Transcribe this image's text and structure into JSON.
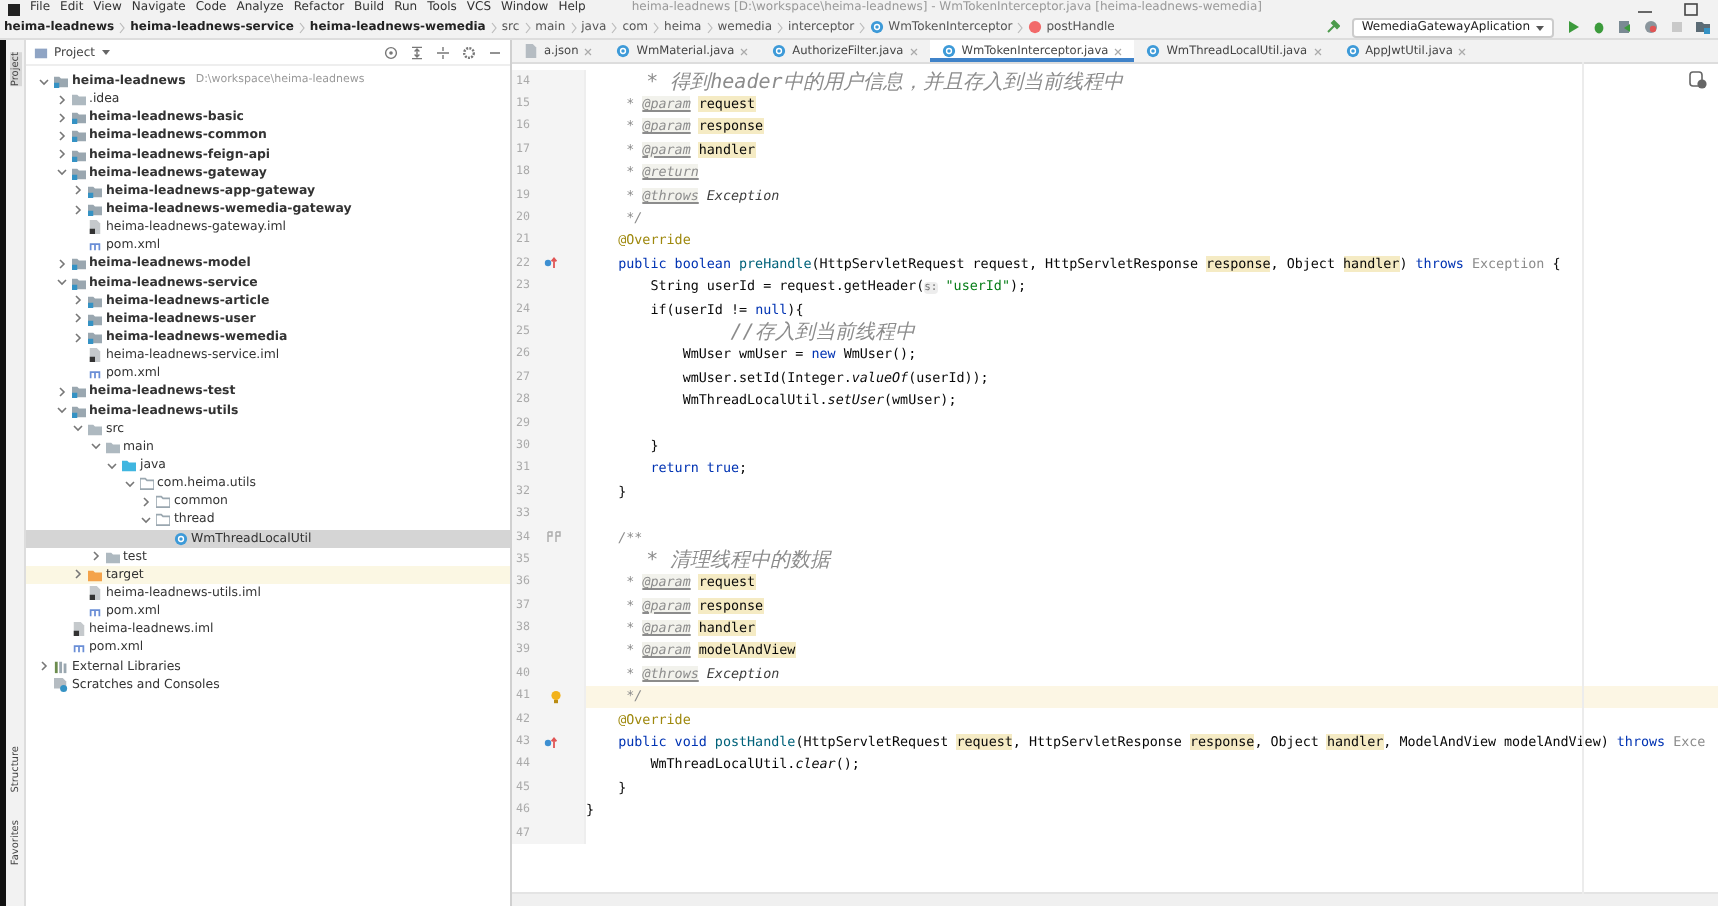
{
  "title_bar": {
    "menu": [
      "File",
      "Edit",
      "View",
      "Navigate",
      "Code",
      "Analyze",
      "Refactor",
      "Build",
      "Run",
      "Tools",
      "VCS",
      "Window",
      "Help"
    ],
    "title": "heima-leadnews [D:\\workspace\\heima-leadnews] - WmTokenInterceptor.java [heima-leadnews-wemedia]"
  },
  "breadcrumbs": [
    {
      "label": "heima-leadnews",
      "kind": "module"
    },
    {
      "label": "heima-leadnews-service",
      "kind": "module"
    },
    {
      "label": "heima-leadnews-wemedia",
      "kind": "module"
    },
    {
      "label": "src",
      "kind": "folder"
    },
    {
      "label": "main",
      "kind": "folder"
    },
    {
      "label": "java",
      "kind": "folder"
    },
    {
      "label": "com",
      "kind": "folder"
    },
    {
      "label": "heima",
      "kind": "folder"
    },
    {
      "label": "wemedia",
      "kind": "folder"
    },
    {
      "label": "interceptor",
      "kind": "folder"
    },
    {
      "label": "WmTokenInterceptor",
      "kind": "class"
    },
    {
      "label": "postHandle",
      "kind": "method"
    }
  ],
  "run_config": "WemediaGatewayAplication",
  "side_strip": [
    "Project",
    "Structure",
    "Favorites"
  ],
  "project": {
    "title": "Project",
    "tree": [
      {
        "label": "heima-leadnews",
        "hint": "D:\\workspace\\heima-leadnews",
        "kind": "module",
        "expanded": true,
        "selected": false,
        "children": [
          {
            "label": ".idea",
            "kind": "folder",
            "expanded": false,
            "selected": false
          },
          {
            "label": "heima-leadnews-basic",
            "kind": "module",
            "expanded": false,
            "selected": false
          },
          {
            "label": "heima-leadnews-common",
            "kind": "module",
            "expanded": false,
            "selected": false
          },
          {
            "label": "heima-leadnews-feign-api",
            "kind": "module",
            "expanded": false,
            "selected": false
          },
          {
            "label": "heima-leadnews-gateway",
            "kind": "module",
            "expanded": true,
            "selected": false,
            "children": [
              {
                "label": "heima-leadnews-app-gateway",
                "kind": "module",
                "expanded": false,
                "selected": false
              },
              {
                "label": "heima-leadnews-wemedia-gateway",
                "kind": "module",
                "expanded": false,
                "selected": false
              },
              {
                "label": "heima-leadnews-gateway.iml",
                "kind": "iml",
                "selected": false
              },
              {
                "label": "pom.xml",
                "kind": "pom",
                "selected": false
              }
            ]
          },
          {
            "label": "heima-leadnews-model",
            "kind": "module",
            "expanded": false,
            "selected": false
          },
          {
            "label": "heima-leadnews-service",
            "kind": "module",
            "expanded": true,
            "selected": false,
            "children": [
              {
                "label": "heima-leadnews-article",
                "kind": "module",
                "expanded": false,
                "selected": false
              },
              {
                "label": "heima-leadnews-user",
                "kind": "module",
                "expanded": false,
                "selected": false
              },
              {
                "label": "heima-leadnews-wemedia",
                "kind": "module",
                "expanded": false,
                "selected": false
              },
              {
                "label": "heima-leadnews-service.iml",
                "kind": "iml",
                "selected": false
              },
              {
                "label": "pom.xml",
                "kind": "pom",
                "selected": false
              }
            ]
          },
          {
            "label": "heima-leadnews-test",
            "kind": "module",
            "expanded": false,
            "selected": false
          },
          {
            "label": "heima-leadnews-utils",
            "kind": "module",
            "expanded": true,
            "selected": false,
            "children": [
              {
                "label": "src",
                "kind": "folder",
                "expanded": true,
                "selected": false,
                "children": [
                  {
                    "label": "main",
                    "kind": "folder",
                    "expanded": true,
                    "selected": false,
                    "children": [
                      {
                        "label": "java",
                        "kind": "source",
                        "expanded": true,
                        "selected": false,
                        "children": [
                          {
                            "label": "com.heima.utils",
                            "kind": "package",
                            "expanded": true,
                            "selected": false,
                            "children": [
                              {
                                "label": "common",
                                "kind": "package",
                                "expanded": false,
                                "selected": false
                              },
                              {
                                "label": "thread",
                                "kind": "package",
                                "expanded": true,
                                "selected": false,
                                "children": [
                                  {
                                    "label": "WmThreadLocalUtil",
                                    "kind": "class",
                                    "selected": true
                                  }
                                ]
                              }
                            ]
                          }
                        ]
                      }
                    ]
                  },
                  {
                    "label": "test",
                    "kind": "folder",
                    "expanded": false,
                    "selected": false
                  }
                ]
              },
              {
                "label": "target",
                "kind": "excluded",
                "expanded": false,
                "selected": false
              },
              {
                "label": "heima-leadnews-utils.iml",
                "kind": "iml",
                "selected": false
              },
              {
                "label": "pom.xml",
                "kind": "pom",
                "selected": false
              }
            ]
          },
          {
            "label": "heima-leadnews.iml",
            "kind": "iml",
            "selected": false
          },
          {
            "label": "pom.xml",
            "kind": "pom",
            "selected": false
          }
        ]
      },
      {
        "label": "External Libraries",
        "kind": "libraries",
        "expanded": false,
        "selected": false
      },
      {
        "label": "Scratches and Consoles",
        "kind": "scratches",
        "selected": false
      }
    ]
  },
  "tabs": [
    {
      "label": "a.json",
      "kind": "json",
      "selected": false
    },
    {
      "label": "WmMaterial.java",
      "kind": "class",
      "selected": false
    },
    {
      "label": "AuthorizeFilter.java",
      "kind": "class",
      "selected": false
    },
    {
      "label": "WmTokenInterceptor.java",
      "kind": "class",
      "selected": true
    },
    {
      "label": "WmThreadLocalUtil.java",
      "kind": "class",
      "selected": false
    },
    {
      "label": "AppJwtUtil.java",
      "kind": "class",
      "selected": false
    }
  ],
  "code": [
    {
      "number": "14",
      "kind": "plain",
      "current": false,
      "segments": [
        {
          "kind": "comment",
          "text": "     * 得到header中的用户信息，并且存入到当前线程中"
        }
      ]
    },
    {
      "number": "15",
      "kind": "plain",
      "current": false,
      "segments": [
        {
          "kind": "comment",
          "text": "     * "
        },
        {
          "kind": "doctag",
          "text": "@param"
        },
        {
          "kind": "param",
          "text": "request"
        }
      ]
    },
    {
      "number": "16",
      "kind": "plain",
      "current": false,
      "segments": [
        {
          "kind": "comment",
          "text": "     * "
        },
        {
          "kind": "doctag",
          "text": "@param"
        },
        {
          "kind": "param",
          "text": "response"
        }
      ]
    },
    {
      "number": "17",
      "kind": "plain",
      "current": false,
      "segments": [
        {
          "kind": "comment",
          "text": "     * "
        },
        {
          "kind": "doctag",
          "text": "@param"
        },
        {
          "kind": "param",
          "text": "handler"
        }
      ]
    },
    {
      "number": "18",
      "kind": "plain",
      "current": false,
      "segments": [
        {
          "kind": "comment",
          "text": "     * "
        },
        {
          "kind": "doctag",
          "text": "@return"
        }
      ]
    },
    {
      "number": "19",
      "kind": "plain",
      "current": false,
      "segments": [
        {
          "kind": "comment",
          "text": "     * "
        },
        {
          "kind": "doctag",
          "text": "@throws"
        },
        {
          "kind": "doctype",
          "text": "Exception"
        }
      ]
    },
    {
      "number": "20",
      "kind": "plain",
      "current": false,
      "segments": [
        {
          "kind": "comment",
          "text": "     */"
        }
      ]
    },
    {
      "number": "21",
      "kind": "plain",
      "current": false,
      "segments": [
        {
          "kind": "annotation",
          "text": "    @Override"
        }
      ]
    },
    {
      "number": "22",
      "kind": "override",
      "current": false,
      "segments": [
        {
          "kind": "keyword",
          "text": "    public boolean "
        },
        {
          "kind": "method",
          "text": "preHandle"
        },
        {
          "kind": "plain",
          "text": "(HttpServletRequest request, HttpServletResponse "
        },
        {
          "kind": "param",
          "text": "response"
        },
        {
          "kind": "plain",
          "text": ", Object "
        },
        {
          "kind": "param",
          "text": "handler"
        },
        {
          "kind": "plain",
          "text": ") "
        },
        {
          "kind": "keyword",
          "text": "throws"
        },
        {
          "kind": "muted",
          "text": " Exception"
        },
        {
          "kind": "plain",
          "text": " {"
        }
      ]
    },
    {
      "number": "23",
      "kind": "plain",
      "current": false,
      "segments": [
        {
          "kind": "plain",
          "text": "        String userId = request.getHeader("
        },
        {
          "kind": "hint",
          "text": "s:"
        },
        {
          "kind": "string",
          "text": " \"userId\""
        },
        {
          "kind": "plain",
          "text": ");"
        }
      ]
    },
    {
      "number": "24",
      "kind": "plain",
      "current": false,
      "segments": [
        {
          "kind": "plain",
          "text": "        if(userId != "
        },
        {
          "kind": "keyword",
          "text": "null"
        },
        {
          "kind": "plain",
          "text": "){"
        }
      ]
    },
    {
      "number": "25",
      "kind": "plain",
      "current": false,
      "segments": [
        {
          "kind": "comment",
          "text": "            //存入到当前线程中"
        }
      ]
    },
    {
      "number": "26",
      "kind": "plain",
      "current": false,
      "segments": [
        {
          "kind": "plain",
          "text": "            WmUser wmUser = "
        },
        {
          "kind": "keyword",
          "text": "new"
        },
        {
          "kind": "plain",
          "text": " WmUser();"
        }
      ]
    },
    {
      "number": "27",
      "kind": "plain",
      "current": false,
      "segments": [
        {
          "kind": "plain",
          "text": "            wmUser.setId(Integer."
        },
        {
          "kind": "italic",
          "text": "valueOf"
        },
        {
          "kind": "plain",
          "text": "(userId));"
        }
      ]
    },
    {
      "number": "28",
      "kind": "plain",
      "current": false,
      "segments": [
        {
          "kind": "plain",
          "text": "            WmThreadLocalUtil."
        },
        {
          "kind": "italic",
          "text": "setUser"
        },
        {
          "kind": "plain",
          "text": "(wmUser);"
        }
      ]
    },
    {
      "number": "29",
      "kind": "plain",
      "current": false
    },
    {
      "number": "30",
      "kind": "plain",
      "current": false,
      "segments": [
        {
          "kind": "plain",
          "text": "        }"
        }
      ]
    },
    {
      "number": "31",
      "kind": "plain",
      "current": false,
      "segments": [
        {
          "kind": "keyword",
          "text": "        return true"
        },
        {
          "kind": "plain",
          "text": ";"
        }
      ]
    },
    {
      "number": "32",
      "kind": "plain",
      "current": false,
      "segments": [
        {
          "kind": "plain",
          "text": "    }"
        }
      ]
    },
    {
      "number": "33",
      "kind": "plain",
      "current": false
    },
    {
      "number": "34",
      "kind": "implements",
      "current": false,
      "segments": [
        {
          "kind": "comment",
          "text": "    /**"
        }
      ]
    },
    {
      "number": "35",
      "kind": "plain",
      "current": false,
      "segments": [
        {
          "kind": "comment",
          "text": "     * 清理线程中的数据"
        }
      ]
    },
    {
      "number": "36",
      "kind": "plain",
      "current": false,
      "segments": [
        {
          "kind": "comment",
          "text": "     * "
        },
        {
          "kind": "doctag",
          "text": "@param"
        },
        {
          "kind": "param",
          "text": "request"
        }
      ]
    },
    {
      "number": "37",
      "kind": "plain",
      "current": false,
      "segments": [
        {
          "kind": "comment",
          "text": "     * "
        },
        {
          "kind": "doctag",
          "text": "@param"
        },
        {
          "kind": "param",
          "text": "response"
        }
      ]
    },
    {
      "number": "38",
      "kind": "plain",
      "current": false,
      "segments": [
        {
          "kind": "comment",
          "text": "     * "
        },
        {
          "kind": "doctag",
          "text": "@param"
        },
        {
          "kind": "param",
          "text": "handler"
        }
      ]
    },
    {
      "number": "39",
      "kind": "plain",
      "current": false,
      "segments": [
        {
          "kind": "comment",
          "text": "     * "
        },
        {
          "kind": "doctag",
          "text": "@param"
        },
        {
          "kind": "param",
          "text": "modelAndView"
        }
      ]
    },
    {
      "number": "40",
      "kind": "plain",
      "current": false,
      "segments": [
        {
          "kind": "comment",
          "text": "     * "
        },
        {
          "kind": "doctag",
          "text": "@throws"
        },
        {
          "kind": "doctype",
          "text": "Exception"
        }
      ]
    },
    {
      "number": "41",
      "kind": "bulb",
      "current": true,
      "segments": [
        {
          "kind": "comment",
          "text": "     */"
        }
      ]
    },
    {
      "number": "42",
      "kind": "plain",
      "current": false,
      "segments": [
        {
          "kind": "annotation",
          "text": "    @Override"
        }
      ]
    },
    {
      "number": "43",
      "kind": "override",
      "current": false,
      "segments": [
        {
          "kind": "keyword",
          "text": "    public void "
        },
        {
          "kind": "method",
          "text": "postHandle"
        },
        {
          "kind": "plain",
          "text": "(HttpServletRequest "
        },
        {
          "kind": "param",
          "text": "request"
        },
        {
          "kind": "plain",
          "text": ", HttpServletResponse "
        },
        {
          "kind": "param",
          "text": "response"
        },
        {
          "kind": "plain",
          "text": ", Object "
        },
        {
          "kind": "param",
          "text": "handler"
        },
        {
          "kind": "plain",
          "text": ", ModelAndView modelAndView) "
        },
        {
          "kind": "keyword",
          "text": "throws"
        },
        {
          "kind": "muted",
          "text": " Exce"
        }
      ]
    },
    {
      "number": "44",
      "kind": "plain",
      "current": false,
      "segments": [
        {
          "kind": "plain",
          "text": "        WmThreadLocalUtil."
        },
        {
          "kind": "italic",
          "text": "clear"
        },
        {
          "kind": "plain",
          "text": "();"
        }
      ]
    },
    {
      "number": "45",
      "kind": "plain",
      "current": false,
      "segments": [
        {
          "kind": "plain",
          "text": "    }"
        }
      ]
    },
    {
      "number": "46",
      "kind": "plain",
      "current": false,
      "segments": [
        {
          "kind": "plain",
          "text": "}"
        }
      ]
    },
    {
      "number": "47",
      "kind": "plain",
      "current": false
    }
  ]
}
